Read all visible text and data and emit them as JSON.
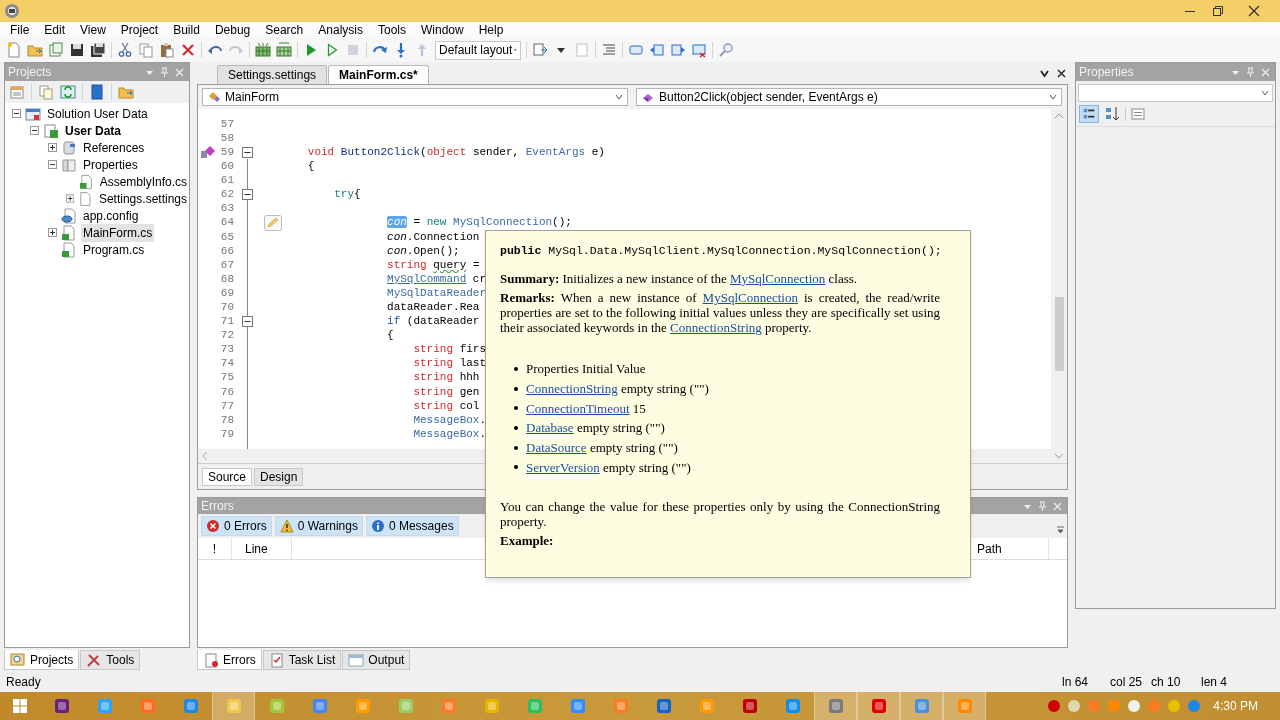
{
  "menu": [
    "File",
    "Edit",
    "View",
    "Project",
    "Build",
    "Debug",
    "Search",
    "Analysis",
    "Tools",
    "Window",
    "Help"
  ],
  "toolbar": {
    "layout_dropdown": "Default layout"
  },
  "projects_panel": {
    "title": "Projects",
    "tree": [
      {
        "label": "Solution User Data",
        "kind": "solution",
        "expanded": true,
        "selected": false,
        "children": [
          {
            "label": "User Data",
            "kind": "project",
            "expanded": true,
            "selected": false,
            "children": [
              {
                "label": "References",
                "kind": "references",
                "expanded": false,
                "selected": false
              },
              {
                "label": "Properties",
                "kind": "folder",
                "expanded": true,
                "selected": false,
                "children": [
                  {
                    "label": "AssemblyInfo.cs",
                    "kind": "cs",
                    "selected": false
                  },
                  {
                    "label": "Settings.settings",
                    "kind": "settings",
                    "expanded": false,
                    "selected": false
                  }
                ]
              },
              {
                "label": "app.config",
                "kind": "config",
                "selected": false
              },
              {
                "label": "MainForm.cs",
                "kind": "cs",
                "expanded": false,
                "selected": true
              },
              {
                "label": "Program.cs",
                "kind": "cs",
                "selected": false
              }
            ]
          }
        ]
      }
    ]
  },
  "document_tabs": [
    {
      "label": "Settings.settings",
      "selected": false
    },
    {
      "label": "MainForm.cs*",
      "selected": true
    }
  ],
  "editor": {
    "class_dropdown": "MainForm",
    "member_dropdown": "Button2Click(object sender, EventArgs e)",
    "lines": [
      {
        "number": "57",
        "kind": "plain",
        "foldable": false
      },
      {
        "number": "58",
        "kind": "plain",
        "foldable": false
      },
      {
        "number": "59",
        "kind": "bookmark",
        "foldable": true,
        "tokens": [
          {
            "text": "   void",
            "kind": "kw"
          },
          {
            "text": " Button2Click",
            "kind": "method"
          },
          {
            "text": "("
          },
          {
            "text": "object",
            "kind": "kw"
          },
          {
            "text": " sender, "
          },
          {
            "text": "EventArgs",
            "kind": "type"
          },
          {
            "text": " e)"
          }
        ]
      },
      {
        "number": "60",
        "kind": "plain",
        "foldable": false,
        "tokens": [
          {
            "text": "   {"
          }
        ]
      },
      {
        "number": "61",
        "kind": "plain",
        "foldable": false
      },
      {
        "number": "62",
        "kind": "plain",
        "foldable": true,
        "tokens": [
          {
            "text": "       try",
            "kind": "ctl"
          },
          {
            "text": "{"
          }
        ]
      },
      {
        "number": "63",
        "kind": "plain",
        "foldable": false
      },
      {
        "number": "64",
        "kind": "edit",
        "foldable": false,
        "tokens": [
          {
            "text": "               con",
            "kind": "sel"
          },
          {
            "text": " = "
          },
          {
            "text": "new",
            "kind": "ctl"
          },
          {
            "text": " MySqlConnection",
            "kind": "type"
          },
          {
            "text": "();"
          }
        ]
      },
      {
        "number": "65",
        "kind": "plain",
        "foldable": false,
        "tokens": [
          {
            "text": "               con",
            "kind": "var"
          },
          {
            "text": ".Connection"
          }
        ]
      },
      {
        "number": "66",
        "kind": "plain",
        "foldable": false,
        "tokens": [
          {
            "text": "               con",
            "kind": "var"
          },
          {
            "text": ".Open();"
          }
        ]
      },
      {
        "number": "67",
        "kind": "plain",
        "foldable": false,
        "tokens": [
          {
            "text": "               string",
            "kind": "kw"
          },
          {
            "text": " query",
            "kind": "warn"
          },
          {
            "text": " ="
          }
        ]
      },
      {
        "number": "68",
        "kind": "plain",
        "foldable": false,
        "tokens": [
          {
            "text": "               MySqlCommand",
            "kind": "typelink"
          },
          {
            "text": " cr"
          }
        ]
      },
      {
        "number": "69",
        "kind": "plain",
        "foldable": false,
        "tokens": [
          {
            "text": "               MySqlDataReader",
            "kind": "type"
          }
        ]
      },
      {
        "number": "70",
        "kind": "plain",
        "foldable": false,
        "tokens": [
          {
            "text": "               dataReader.Rea"
          }
        ]
      },
      {
        "number": "71",
        "kind": "plain",
        "foldable": true,
        "tokens": [
          {
            "text": "               if",
            "kind": "if"
          },
          {
            "text": " (dataReader"
          }
        ]
      },
      {
        "number": "72",
        "kind": "plain",
        "foldable": false,
        "tokens": [
          {
            "text": "               {"
          }
        ]
      },
      {
        "number": "73",
        "kind": "plain",
        "foldable": false,
        "tokens": [
          {
            "text": "                   string",
            "kind": "kw"
          },
          {
            "text": " firs"
          }
        ]
      },
      {
        "number": "74",
        "kind": "plain",
        "foldable": false,
        "tokens": [
          {
            "text": "                   string",
            "kind": "kw"
          },
          {
            "text": " last"
          }
        ]
      },
      {
        "number": "75",
        "kind": "plain",
        "foldable": false,
        "tokens": [
          {
            "text": "                   string",
            "kind": "kw"
          },
          {
            "text": " hhh"
          }
        ]
      },
      {
        "number": "76",
        "kind": "plain",
        "foldable": false,
        "tokens": [
          {
            "text": "                   string",
            "kind": "kw"
          },
          {
            "text": " gen"
          }
        ]
      },
      {
        "number": "77",
        "kind": "plain",
        "foldable": false,
        "tokens": [
          {
            "text": "                   string",
            "kind": "kw"
          },
          {
            "text": " col"
          }
        ]
      },
      {
        "number": "78",
        "kind": "plain",
        "foldable": false,
        "tokens": [
          {
            "text": "                   MessageBox",
            "kind": "type"
          },
          {
            "text": "."
          }
        ]
      },
      {
        "number": "79",
        "kind": "plain",
        "foldable": false,
        "tokens": [
          {
            "text": "                   MessageBox",
            "kind": "type"
          },
          {
            "text": "."
          }
        ]
      }
    ],
    "view_tabs": [
      {
        "label": "Source",
        "selected": true
      },
      {
        "label": "Design",
        "selected": false
      }
    ]
  },
  "tooltip": {
    "signature": "**public** MySql.Data.MySqlClient.MySqlConnection.MySqlConnection();",
    "paragraphs": [
      {
        "segments": [
          {
            "text": "Summary:",
            "kind": "bold"
          },
          {
            "text": " Initializes a new instance of the "
          },
          {
            "text": "MySqlConnection",
            "kind": "link"
          },
          {
            "text": " class."
          }
        ]
      },
      {
        "segments": [
          {
            "text": "Remarks:",
            "kind": "bold"
          },
          {
            "text": " When a new instance of "
          },
          {
            "text": "MySqlConnection",
            "kind": "link"
          },
          {
            "text": " is created, the read/write properties are set to the following initial values unless they are specifically set using their associated keywords in the "
          },
          {
            "text": "ConnectionString",
            "kind": "link"
          },
          {
            "text": " property."
          }
        ]
      }
    ],
    "bullets": [
      {
        "segments": [
          {
            "text": "Properties Initial Value"
          }
        ]
      },
      {
        "segments": [
          {
            "text": "ConnectionString",
            "kind": "link"
          },
          {
            "text": " empty string (\"\")"
          }
        ]
      },
      {
        "segments": [
          {
            "text": "ConnectionTimeout",
            "kind": "link"
          },
          {
            "text": " 15"
          }
        ]
      },
      {
        "segments": [
          {
            "text": "Database",
            "kind": "link"
          },
          {
            "text": " empty string (\"\")"
          }
        ]
      },
      {
        "segments": [
          {
            "text": "DataSource",
            "kind": "link"
          },
          {
            "text": " empty string (\"\")"
          }
        ]
      },
      {
        "segments": [
          {
            "text": "ServerVersion",
            "kind": "link"
          },
          {
            "text": " empty string (\"\")"
          }
        ]
      }
    ],
    "note": "You can change the value for these properties only by using the ConnectionString property.",
    "example": "Example:"
  },
  "errors_panel": {
    "title": "Errors",
    "filters": [
      {
        "label": "0 Errors",
        "kind": "error",
        "selected": true
      },
      {
        "label": "0 Warnings",
        "kind": "warning",
        "selected": true
      },
      {
        "label": "0 Messages",
        "kind": "info",
        "selected": true
      }
    ],
    "columns": [
      "!",
      "Line",
      "Path"
    ]
  },
  "left_tabs": [
    {
      "label": "Projects",
      "selected": true
    },
    {
      "label": "Tools",
      "selected": false
    }
  ],
  "bottom_tabs": [
    {
      "label": "Errors",
      "kind": "errors",
      "selected": true
    },
    {
      "label": "Task List",
      "kind": "tasks",
      "selected": false
    },
    {
      "label": "Output",
      "kind": "output",
      "selected": false
    }
  ],
  "properties_panel": {
    "title": "Properties"
  },
  "status_bar": {
    "message": "Ready",
    "line": "ln 64",
    "column": "col 25",
    "character": "ch 10",
    "length": "len 4"
  },
  "taskbar": {
    "apps": [
      {
        "color": "#68217a",
        "active": false
      },
      {
        "color": "#2fa3f5",
        "active": false
      },
      {
        "color": "#ff6a1f",
        "active": false
      },
      {
        "color": "#1e88e5",
        "active": false
      },
      {
        "color": "#f2c84b",
        "active": true
      },
      {
        "color": "#a4c639",
        "active": false
      },
      {
        "color": "#4285f4",
        "active": false
      },
      {
        "color": "#ff9a00",
        "active": false
      },
      {
        "color": "#9ccc65",
        "active": false
      },
      {
        "color": "#fb7a24",
        "active": false
      },
      {
        "color": "#e8b400",
        "active": false
      },
      {
        "color": "#2dbe60",
        "active": false
      },
      {
        "color": "#2d8cff",
        "active": false
      },
      {
        "color": "#fb7a24",
        "active": false
      },
      {
        "color": "#1565c0",
        "active": false
      },
      {
        "color": "#ff9800",
        "active": false
      },
      {
        "color": "#bf0000",
        "active": false
      },
      {
        "color": "#0e8ee9",
        "active": false
      },
      {
        "color": "#7a7a7a",
        "active": true
      },
      {
        "color": "#e00000",
        "active": true
      },
      {
        "color": "#4a90d9",
        "active": true
      },
      {
        "color": "#ff8800",
        "active": true
      }
    ],
    "tray": [
      {
        "color": "#d00000"
      },
      {
        "color": "#e0d8b0"
      },
      {
        "color": "#fb7a24"
      },
      {
        "color": "#ff8800"
      },
      {
        "color": "#f0f0f0"
      },
      {
        "color": "#fb7a24"
      },
      {
        "color": "#e8c000"
      },
      {
        "color": "#1e88e5"
      }
    ],
    "clock": "4:30 PM"
  }
}
